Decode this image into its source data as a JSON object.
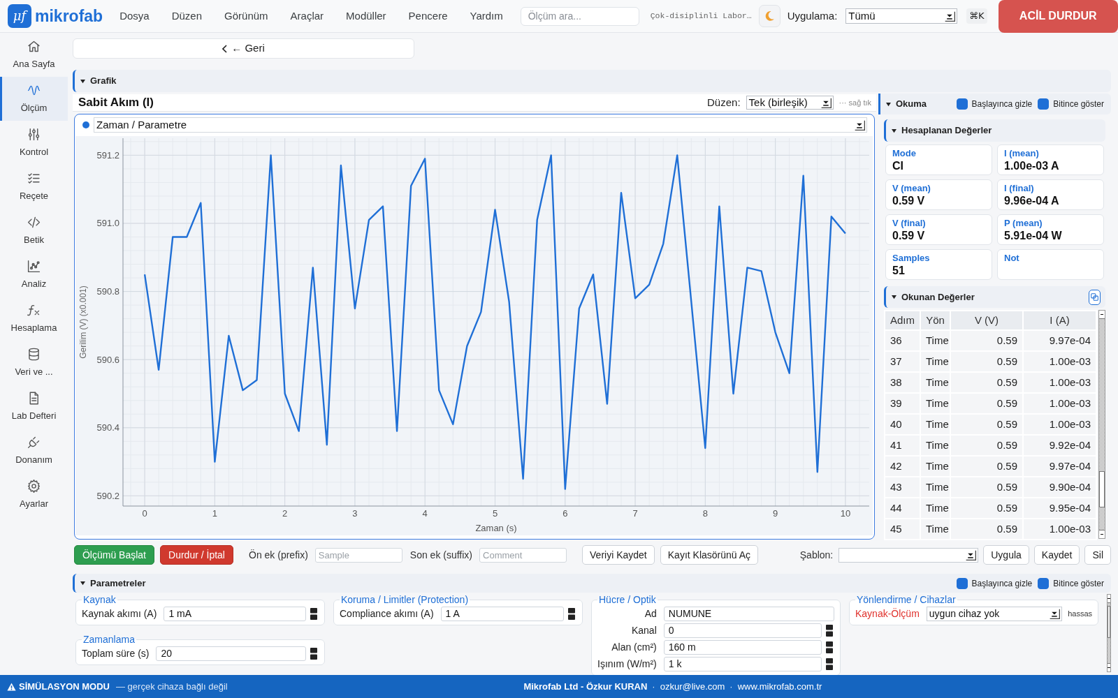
{
  "header": {
    "logo_mark": "μf",
    "logo_text": "mikrofab",
    "menu": [
      "Dosya",
      "Düzen",
      "Görünüm",
      "Araçlar",
      "Modüller",
      "Pencere",
      "Yardım"
    ],
    "search": {
      "placeholder": "Ölçüm ara..."
    },
    "lab_name": "Çok-disiplinli Labor…",
    "application": {
      "label": "Uygulama:",
      "value": "Tümü"
    },
    "shortcut": "⌘K",
    "emergency_stop": "ACİL DURDUR"
  },
  "sidebar": {
    "items": [
      {
        "label": "Ana Sayfa",
        "selected": false
      },
      {
        "label": "Ölçüm",
        "selected": true
      },
      {
        "label": "Kontrol",
        "selected": false
      },
      {
        "label": "Reçete",
        "selected": false
      },
      {
        "label": "Betik",
        "selected": false
      },
      {
        "label": "Analiz",
        "selected": false
      },
      {
        "label": "Hesaplama",
        "selected": false
      },
      {
        "label": "Veri ve ...",
        "selected": false
      },
      {
        "label": "Lab Defteri",
        "selected": false
      },
      {
        "label": "Donanım",
        "selected": false
      },
      {
        "label": "Ayarlar",
        "selected": false
      }
    ]
  },
  "back_button": "← Geri",
  "graph_section": {
    "title": "Grafik",
    "expanded": true,
    "chart_title": "Sabit Akım (I)",
    "layout": {
      "label": "Düzen:",
      "value": "Tek (birleşik)"
    },
    "hint": "··· sağ tık",
    "trace": {
      "value": "Zaman / Parametre",
      "color": "#1f6fd6"
    },
    "chart_data": {
      "type": "line",
      "xlabel": "Zaman (s)",
      "ylabel": "Gerilim (V) (x0.001)",
      "grid": true,
      "x": [
        0,
        0.2,
        0.4,
        0.6,
        0.8,
        1,
        1.2,
        1.4,
        1.6,
        1.8,
        2,
        2.2,
        2.4,
        2.6,
        2.8,
        3,
        3.2,
        3.4,
        3.6,
        3.8,
        4,
        4.2,
        4.4,
        4.6,
        4.8,
        5,
        5.2,
        5.4,
        5.6,
        5.8,
        6,
        6.2,
        6.4,
        6.6,
        6.8,
        7,
        7.2,
        7.4,
        7.6,
        7.8,
        8,
        8.2,
        8.4,
        8.6,
        8.8,
        9,
        9.2,
        9.4,
        9.6,
        9.8,
        10
      ],
      "series": [
        {
          "color": "#1f6fd6",
          "values": [
            590.85,
            590.57,
            590.96,
            590.96,
            591.06,
            590.3,
            590.67,
            590.51,
            590.54,
            591.2,
            590.5,
            590.39,
            590.87,
            590.35,
            591.17,
            590.75,
            591.01,
            591.05,
            590.39,
            591.11,
            591.19,
            590.51,
            590.41,
            590.64,
            590.74,
            591.04,
            590.77,
            590.25,
            591.01,
            591.2,
            590.22,
            590.75,
            590.85,
            590.47,
            591.09,
            590.78,
            590.82,
            590.94,
            591.2,
            590.77,
            590.34,
            591.05,
            590.5,
            590.87,
            590.86,
            590.68,
            590.56,
            591.14,
            590.27,
            591.02,
            590.97
          ]
        }
      ],
      "xlim": [
        -0.31,
        10.34
      ],
      "ylim": [
        590.17,
        591.25
      ],
      "xticks": [
        0,
        1,
        2,
        3,
        4,
        5,
        6,
        7,
        8,
        9,
        10
      ],
      "yticks": [
        {
          "value": 590.2,
          "label": "590.2"
        },
        {
          "value": 590.4,
          "label": "590.4"
        },
        {
          "value": 590.6,
          "label": "590.6"
        },
        {
          "value": 590.8,
          "label": "590.8"
        },
        {
          "value": 591.0,
          "label": "591.0"
        },
        {
          "value": 591.2,
          "label": "591.2"
        }
      ]
    }
  },
  "reading_panel": {
    "title": "Okuma",
    "expanded": true,
    "options": [
      {
        "label": "Başlayınca gizle",
        "checked": true
      },
      {
        "label": "Bitince göster",
        "checked": true
      }
    ],
    "computed": {
      "title": "Hesaplanan Değerler",
      "expanded": true,
      "stats": [
        {
          "label": "Mode",
          "value": "CI"
        },
        {
          "label": "I (mean)",
          "value": "1.00e-03 A"
        },
        {
          "label": "V (mean)",
          "value": "0.59 V"
        },
        {
          "label": "I (final)",
          "value": "9.96e-04 A"
        },
        {
          "label": "V (final)",
          "value": "0.59 V"
        },
        {
          "label": "P (mean)",
          "value": "5.91e-04 W"
        },
        {
          "label": "Samples",
          "value": "51"
        },
        {
          "label": "Not"
        }
      ]
    },
    "readings": {
      "title": "Okunan Değerler",
      "expanded": true,
      "columns": [
        "Adım",
        "Yön",
        "V (V)",
        "I (A)"
      ],
      "rows": [
        [
          "36",
          "Time",
          "0.59",
          "9.97e-04"
        ],
        [
          "37",
          "Time",
          "0.59",
          "1.00e-03"
        ],
        [
          "38",
          "Time",
          "0.59",
          "1.00e-03"
        ],
        [
          "39",
          "Time",
          "0.59",
          "1.00e-03"
        ],
        [
          "40",
          "Time",
          "0.59",
          "1.00e-03"
        ],
        [
          "41",
          "Time",
          "0.59",
          "9.92e-04"
        ],
        [
          "42",
          "Time",
          "0.59",
          "9.97e-04"
        ],
        [
          "43",
          "Time",
          "0.59",
          "9.90e-04"
        ],
        [
          "44",
          "Time",
          "0.59",
          "9.95e-04"
        ],
        [
          "45",
          "Time",
          "0.59",
          "1.00e-03"
        ]
      ]
    }
  },
  "action_bar": {
    "run_buttons": [
      {
        "label": "Ölçümü Başlat",
        "kind": "start"
      },
      {
        "label": "Durdur / İptal",
        "kind": "stop"
      }
    ],
    "name_fields": [
      {
        "label": "Ön ek (prefix)",
        "placeholder": "Sample"
      },
      {
        "label": "Son ek (suffix)",
        "placeholder": "Comment"
      }
    ],
    "file_buttons": [
      "Veriyi Kaydet",
      "Kayıt Klasörünü Aç"
    ],
    "template": {
      "label": "Şablon:",
      "buttons": [
        "Uygula",
        "Kaydet",
        "Sil"
      ]
    }
  },
  "parameters": {
    "title": "Parametreler",
    "expanded": true,
    "options": [
      {
        "label": "Başlayınca gizle",
        "checked": true
      },
      {
        "label": "Bitince göster",
        "checked": true
      }
    ],
    "columns": [
      {
        "groups": [
          {
            "title": "Kaynak",
            "fields": [
              {
                "kind": "number",
                "label": "Kaynak akımı (A)",
                "value": "1 mA"
              }
            ]
          },
          {
            "title": "Zamanlama",
            "fields": [
              {
                "kind": "number",
                "label": "Toplam süre (s)",
                "value": "20"
              }
            ]
          }
        ]
      },
      {
        "groups": [
          {
            "title": "Koruma / Limitler (Protection)",
            "fields": [
              {
                "kind": "number",
                "label": "Compliance akımı (A)",
                "value": "1 A"
              }
            ]
          }
        ]
      },
      {
        "groups": [
          {
            "title": "Hücre / Optik",
            "fields": [
              {
                "kind": "text",
                "label": "Ad",
                "value": "NUMUNE"
              },
              {
                "kind": "number",
                "label": "Kanal",
                "value": "0"
              },
              {
                "kind": "number",
                "label": "Alan (cm²)",
                "value": "160 m"
              },
              {
                "kind": "number",
                "label": "Işınım (W/m²)",
                "value": "1 k"
              }
            ]
          }
        ]
      },
      {
        "groups": [
          {
            "title": "Yönlendirme / Cihazlar",
            "fields": [
              {
                "kind": "device",
                "label": "Kaynak-Ölçüm",
                "value": "uygun cihaz yok",
                "note": "hassas",
                "unavailable": true
              }
            ]
          }
        ]
      }
    ]
  },
  "status_bar": {
    "mode": "SİMÜLASYON MODU",
    "mode_note": "— gerçek cihaza bağlı değil",
    "credits": [
      {
        "kind": "owner",
        "text": "Mikrofab Ltd - Özkur KURAN"
      },
      {
        "kind": "separator",
        "text": "·"
      },
      {
        "kind": "email",
        "text": "ozkur@live.com"
      },
      {
        "kind": "separator",
        "text": "·"
      },
      {
        "kind": "website",
        "text": "www.mikrofab.com.tr"
      }
    ]
  }
}
